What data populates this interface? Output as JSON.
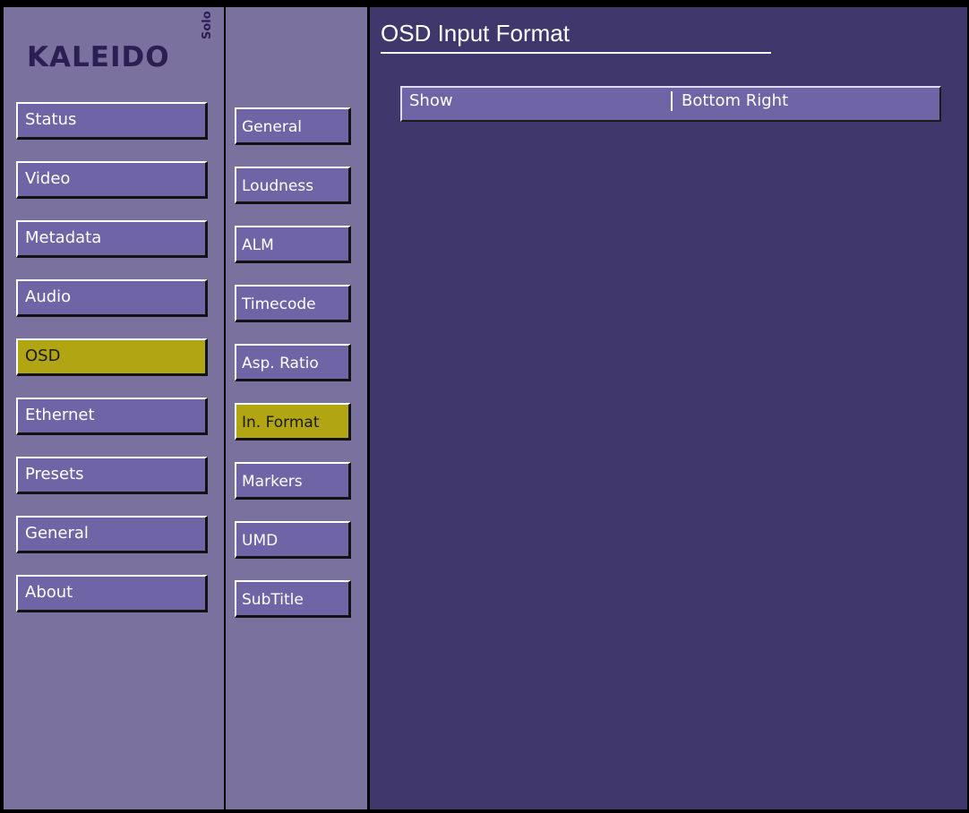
{
  "logo": {
    "brand": "KALEIDO",
    "sub": "Solo"
  },
  "main_menu": [
    {
      "label": "Status",
      "active": false
    },
    {
      "label": "Video",
      "active": false
    },
    {
      "label": "Metadata",
      "active": false
    },
    {
      "label": "Audio",
      "active": false
    },
    {
      "label": "OSD",
      "active": true
    },
    {
      "label": "Ethernet",
      "active": false
    },
    {
      "label": "Presets",
      "active": false
    },
    {
      "label": "General",
      "active": false
    },
    {
      "label": "About",
      "active": false
    }
  ],
  "sub_menu": [
    {
      "label": "General",
      "active": false
    },
    {
      "label": "Loudness",
      "active": false
    },
    {
      "label": "ALM",
      "active": false
    },
    {
      "label": "Timecode",
      "active": false
    },
    {
      "label": "Asp. Ratio",
      "active": false
    },
    {
      "label": "In. Format",
      "active": true
    },
    {
      "label": "Markers",
      "active": false
    },
    {
      "label": "UMD",
      "active": false
    },
    {
      "label": "SubTitle",
      "active": false
    }
  ],
  "page": {
    "title": "OSD Input Format",
    "setting": {
      "label": "Show",
      "value": "Bottom Right"
    }
  },
  "colors": {
    "panel_bg": "#7a719e",
    "main_bg": "#40386c",
    "button_bg": "#6f64a6",
    "active_bg": "#b2a514"
  }
}
